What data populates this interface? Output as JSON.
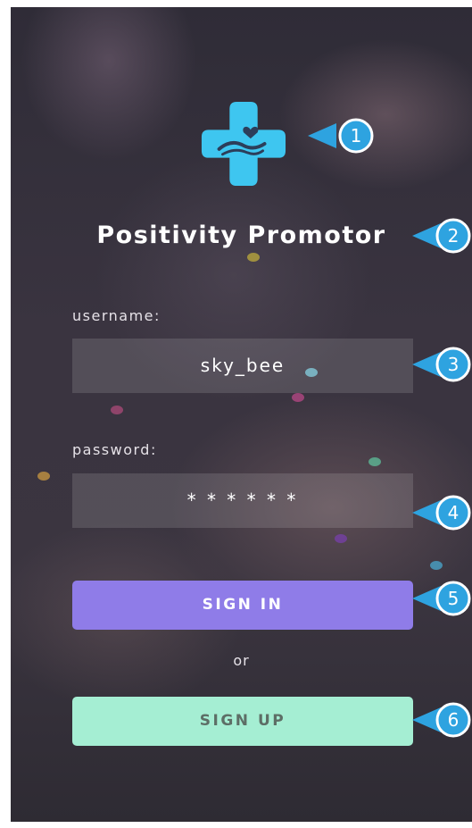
{
  "app": {
    "title": "Positivity Promotor"
  },
  "form": {
    "username_label": "username:",
    "username_value": "sky_bee",
    "password_label": "password:",
    "password_value": "* * * * * *"
  },
  "actions": {
    "sign_in_label": "SIGN IN",
    "or_label": "or",
    "sign_up_label": "SIGN UP"
  },
  "annotations": [
    "1",
    "2",
    "3",
    "4",
    "5",
    "6"
  ],
  "colors": {
    "logo": "#3ec6f0",
    "sign_in": "#8f7ce8",
    "sign_up": "#a5eed3",
    "callout": "#2ea3e0"
  },
  "icons": {
    "logo": "plus-with-hands-heart-icon"
  }
}
